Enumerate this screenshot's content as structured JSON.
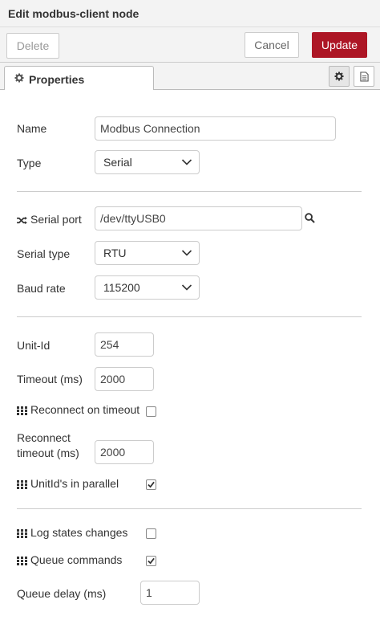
{
  "dialog": {
    "title": "Edit modbus-client node"
  },
  "toolbar": {
    "delete_label": "Delete",
    "cancel_label": "Cancel",
    "update_label": "Update",
    "update_color": "#ad1625"
  },
  "tabs": {
    "properties_label": "Properties"
  },
  "form": {
    "name": {
      "label": "Name",
      "value": "Modbus Connection"
    },
    "type": {
      "label": "Type",
      "value": "Serial"
    },
    "serial_port": {
      "label": "Serial port",
      "value": "/dev/ttyUSB0"
    },
    "serial_type": {
      "label": "Serial type",
      "value": "RTU"
    },
    "baud_rate": {
      "label": "Baud rate",
      "value": "115200"
    },
    "unit_id": {
      "label": "Unit-Id",
      "value": "254"
    },
    "timeout": {
      "label": "Timeout (ms)",
      "value": "2000"
    },
    "reconnect_on_timeout": {
      "label": "Reconnect on timeout",
      "checked": false
    },
    "reconnect_timeout": {
      "label_line1": "Reconnect",
      "label_line2": "timeout (ms)",
      "value": "2000"
    },
    "unitids_parallel": {
      "label": "UnitId's in parallel",
      "checked": true
    },
    "log_states": {
      "label": "Log states changes",
      "checked": false
    },
    "queue_commands": {
      "label": "Queue commands",
      "checked": true
    },
    "queue_delay": {
      "label": "Queue delay (ms)",
      "value": "1"
    }
  },
  "icons": {
    "tab": "gear-icon",
    "settings": "gear-icon",
    "info": "document-icon",
    "serial_port": "shuffle-icon",
    "search": "search-icon",
    "grid": "grid-icon",
    "chevron": "chevron-down-icon"
  }
}
